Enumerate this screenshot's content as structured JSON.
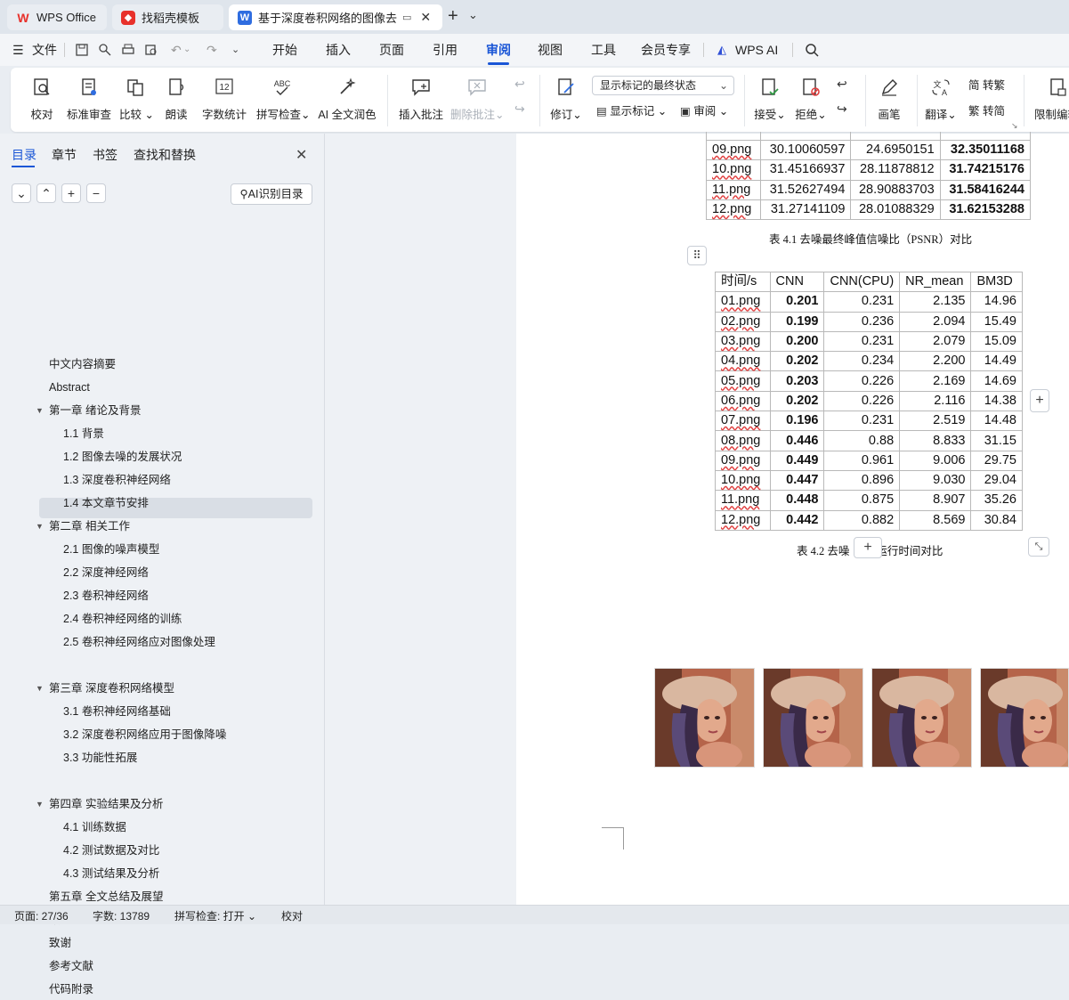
{
  "titlebar": {
    "tabs": [
      {
        "label": "WPS Office",
        "icon": "wps-logo-icon"
      },
      {
        "label": "找稻壳模板",
        "icon": "docer-logo-icon"
      },
      {
        "label": "基于深度卷积网络的图像去噪",
        "icon": "writer-doc-icon"
      }
    ],
    "new_tab": "+",
    "dropdown": "⌄"
  },
  "menubar": {
    "file": "文件",
    "items": [
      "开始",
      "插入",
      "页面",
      "引用",
      "审阅",
      "视图",
      "工具",
      "会员专享"
    ],
    "active": "审阅",
    "wps_ai": "WPS AI"
  },
  "ribbon": {
    "proofread": "校对",
    "standard_review": "标准审查",
    "compare": "比较",
    "read_aloud": "朗读",
    "word_count": "字数统计",
    "spell_check": "拼写检查",
    "ai_polish": "AI 全文润色",
    "insert_comment": "插入批注",
    "delete_comment": "删除批注",
    "track_changes": "修订",
    "markup_state": "显示标记的最终状态",
    "show_markup": "显示标记",
    "review_pane": "审阅",
    "accept": "接受",
    "reject": "拒绝",
    "pen": "画笔",
    "translate": "翻译",
    "to_traditional": "转繁",
    "to_simplified": "转简",
    "restrict_edit": "限制编辑",
    "word_count_icon_text": "12",
    "spell_icon_text": "ABC"
  },
  "navpane": {
    "tabs": [
      "目录",
      "章节",
      "书签",
      "查找和替换"
    ],
    "active_tab": "目录",
    "controls": [
      "⌄",
      "⌃",
      "+",
      "−"
    ],
    "ai_toc": "AI识别目录",
    "toc": [
      {
        "level": 0,
        "label": "中文内容摘要"
      },
      {
        "level": 0,
        "label": "Abstract"
      },
      {
        "level": 0,
        "label": "第一章  绪论及背景",
        "expanded": true
      },
      {
        "level": 1,
        "label": "1.1 背景"
      },
      {
        "level": 1,
        "label": "1.2  图像去噪的发展状况"
      },
      {
        "level": 1,
        "label": "1.3  深度卷积神经网络"
      },
      {
        "level": 1,
        "label": "1.4  本文章节安排"
      },
      {
        "level": 0,
        "label": "第二章  相关工作",
        "expanded": true
      },
      {
        "level": 1,
        "label": "2.1 图像的噪声模型"
      },
      {
        "level": 1,
        "label": "2.2 深度神经网络"
      },
      {
        "level": 1,
        "label": "2.3 卷积神经网络"
      },
      {
        "level": 1,
        "label": "2.4  卷积神经网络的训练"
      },
      {
        "level": 1,
        "label": "2.5  卷积神经网络应对图像处理",
        "selected": true
      },
      {
        "level": 0,
        "label": "第三章  深度卷积网络模型",
        "expanded": true
      },
      {
        "level": 1,
        "label": "3.1  卷积神经网络基础"
      },
      {
        "level": 1,
        "label": "3.2  深度卷积网络应用于图像降噪"
      },
      {
        "level": 1,
        "label": "3.3  功能性拓展"
      },
      {
        "level": 0,
        "label": "第四章  实验结果及分析",
        "expanded": true
      },
      {
        "level": 1,
        "label": "4.1  训练数据"
      },
      {
        "level": 1,
        "label": "4.2  测试数据及对比"
      },
      {
        "level": 1,
        "label": "4.3  测试结果及分析"
      },
      {
        "level": 0,
        "label": "第五章  全文总结及展望"
      },
      {
        "level": 0,
        "label": "致谢"
      },
      {
        "level": 0,
        "label": "致谢"
      },
      {
        "level": 0,
        "label": "参考文献"
      },
      {
        "level": 0,
        "label": "代码附录"
      }
    ]
  },
  "document": {
    "psnr_rows": [
      [
        "09.png",
        "30.10060597",
        "24.6950151",
        "32.35011168"
      ],
      [
        "10.png",
        "31.45166937",
        "28.11878812",
        "31.74215176"
      ],
      [
        "11.png",
        "31.52627494",
        "28.90883703",
        "31.58416244"
      ],
      [
        "12.png",
        "31.27141109",
        "28.01088329",
        "31.62153288"
      ]
    ],
    "caption1": "表 4.1  去噪最终峰值信噪比（PSNR）对比",
    "time_header": [
      "时间/s",
      "CNN",
      "CNN(CPU)",
      "NR_mean",
      "BM3D"
    ],
    "time_rows": [
      [
        "01.png",
        "0.201",
        "0.231",
        "2.135",
        "14.96"
      ],
      [
        "02.png",
        "0.199",
        "0.236",
        "2.094",
        "15.49"
      ],
      [
        "03.png",
        "0.200",
        "0.231",
        "2.079",
        "15.09"
      ],
      [
        "04.png",
        "0.202",
        "0.234",
        "2.200",
        "14.49"
      ],
      [
        "05.png",
        "0.203",
        "0.226",
        "2.169",
        "14.69"
      ],
      [
        "06.png",
        "0.202",
        "0.226",
        "2.116",
        "14.38"
      ],
      [
        "07.png",
        "0.196",
        "0.231",
        "2.519",
        "14.48"
      ],
      [
        "08.png",
        "0.446",
        "0.88",
        "8.833",
        "31.15"
      ],
      [
        "09.png",
        "0.449",
        "0.961",
        "9.006",
        "29.75"
      ],
      [
        "10.png",
        "0.447",
        "0.896",
        "9.030",
        "29.04"
      ],
      [
        "11.png",
        "0.448",
        "0.875",
        "8.907",
        "35.26"
      ],
      [
        "12.png",
        "0.442",
        "0.882",
        "8.569",
        "30.84"
      ]
    ],
    "caption2_left": "表  4.2  去噪",
    "caption2_right": "运行时间对比",
    "table_handle": "⠿",
    "add_row": "+",
    "add_col": "+"
  },
  "statusbar": {
    "page": "页面: 27/36",
    "words": "字数: 13789",
    "spell": "拼写检查: 打开",
    "proof": "校对"
  }
}
